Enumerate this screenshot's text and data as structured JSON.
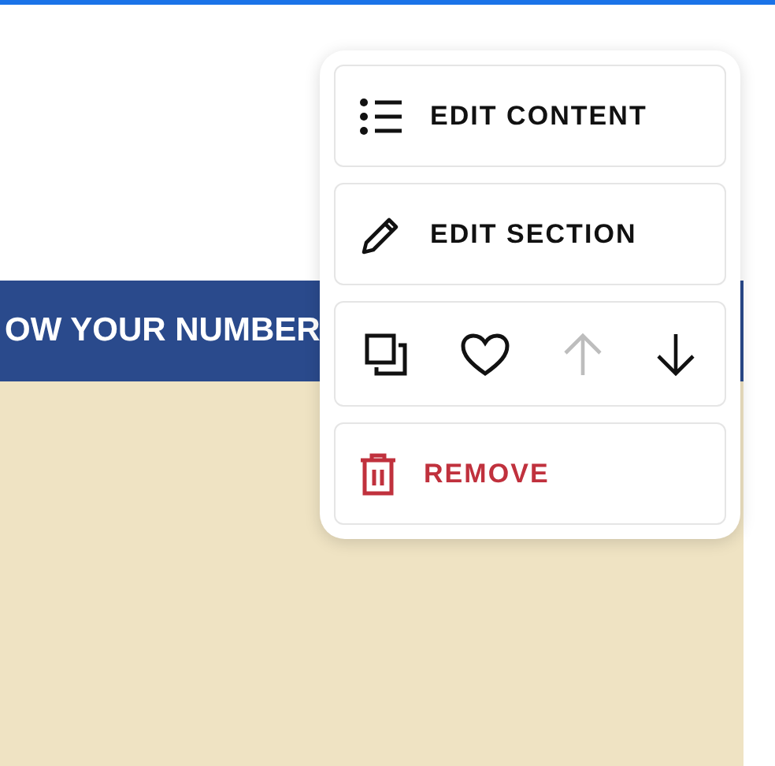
{
  "banner": {
    "text": "OW YOUR NUMBER"
  },
  "menu": {
    "items": [
      {
        "kind": "action",
        "label": "EDIT CONTENT"
      },
      {
        "kind": "action",
        "label": "EDIT SECTION"
      },
      {
        "kind": "icons",
        "buttons": [
          {
            "disabled": false
          },
          {
            "disabled": false
          },
          {
            "disabled": true
          },
          {
            "disabled": false
          }
        ]
      },
      {
        "kind": "danger",
        "label": "REMOVE"
      }
    ]
  }
}
